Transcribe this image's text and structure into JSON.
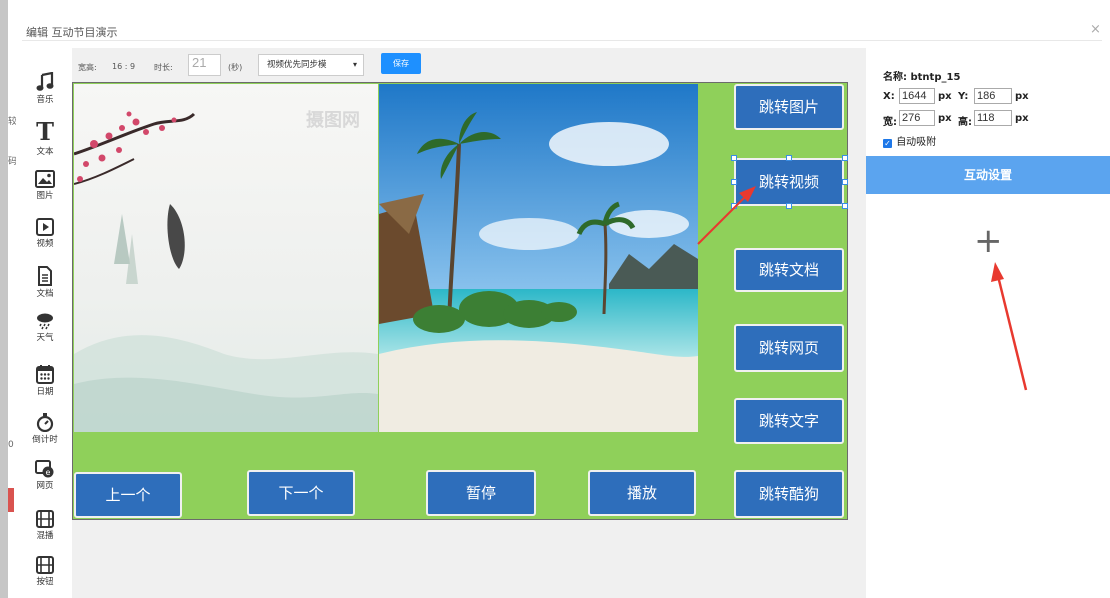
{
  "dialog": {
    "title": "编辑 互动节目演示",
    "close_glyph": "×"
  },
  "outer_fragments": [
    "较",
    "码",
    "0"
  ],
  "tools": [
    {
      "key": "music",
      "label": "音乐",
      "icon": "music-note-icon"
    },
    {
      "key": "text",
      "label": "文本",
      "icon": "text-t-icon",
      "glyph": "T"
    },
    {
      "key": "image",
      "label": "图片",
      "icon": "image-icon"
    },
    {
      "key": "video",
      "label": "视频",
      "icon": "video-play-icon"
    },
    {
      "key": "document",
      "label": "文档",
      "icon": "document-icon"
    },
    {
      "key": "weather",
      "label": "天气",
      "icon": "weather-icon"
    },
    {
      "key": "date",
      "label": "日期",
      "icon": "calendar-icon"
    },
    {
      "key": "countdown",
      "label": "倒计时",
      "icon": "stopwatch-icon"
    },
    {
      "key": "webpage",
      "label": "网页",
      "icon": "browser-icon"
    },
    {
      "key": "mixed",
      "label": "混播",
      "icon": "mixed-play-icon"
    },
    {
      "key": "button",
      "label": "按钮",
      "icon": "button-icon"
    }
  ],
  "editor_toolbar": {
    "aspect_label": "宽高:",
    "aspect_value": "16 : 9",
    "duration_label": "时长:",
    "duration_value": "21",
    "seconds_label": "(秒)",
    "mode_selected": "视频优先同步模",
    "save_label": "保存"
  },
  "canvas": {
    "background_color": "#8fd05a",
    "watermark": "摄图网",
    "right_buttons": [
      "跳转图片",
      "跳转视频",
      "跳转文档",
      "跳转网页",
      "跳转文字",
      "跳转酷狗"
    ],
    "bottom_buttons": [
      "上一个",
      "下一个",
      "暂停",
      "播放"
    ],
    "selected_button": "跳转视频"
  },
  "properties": {
    "name_label": "名称:",
    "name_value": "btntp_15",
    "x_label": "X:",
    "x_value": "1644",
    "y_label": "Y:",
    "y_value": "186",
    "width_label": "宽:",
    "width_value": "276",
    "height_label": "高:",
    "height_value": "118",
    "unit": "px",
    "auto_snap_label": "自动吸附",
    "auto_snap_checked": true,
    "interaction_label": "互动设置",
    "add_glyph": "+"
  },
  "colors": {
    "accent_blue": "#5ba4ef",
    "button_blue": "#2e6ebb",
    "annotation_red": "#e8392f"
  }
}
